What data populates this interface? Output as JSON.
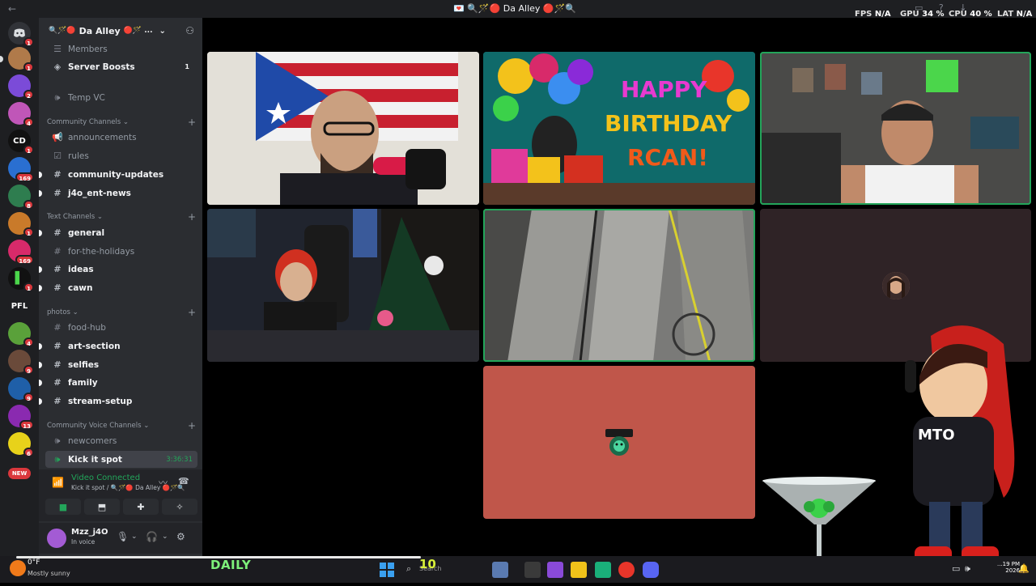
{
  "titlebar": {
    "title": "💌 🔍🪄🔴 Da Alley 🔴🪄🔍",
    "back": "←"
  },
  "perf": {
    "fps_label": "FPS",
    "fps_value": "N/A",
    "gpu_label": "GPU",
    "gpu_value": "34 %",
    "cpu_label": "CPU",
    "cpu_value": "40 %",
    "lat_label": "LAT",
    "lat_value": "N/A"
  },
  "server_rail": {
    "badges": [
      "1",
      "1",
      "2",
      "4",
      "1",
      "169",
      "8",
      "1",
      "169",
      "1",
      "4",
      "9",
      "9",
      "13",
      "6"
    ],
    "text_icons": {
      "cd": "CD",
      "pfl": "PFL"
    },
    "new_tag": "NEW"
  },
  "guild": {
    "name": "Da Alley",
    "prefix": "🔍🪄🔴",
    "suffix": "🔴🪄 ..."
  },
  "channels": {
    "members": "Members",
    "server_boosts": "Server Boosts",
    "server_boosts_badge": "1",
    "temp_vc": "Temp VC",
    "community_category": "Community Channels",
    "announcements": "announcements",
    "rules": "rules",
    "community_updates": "community-updates",
    "j4o_news": "j4o_ent-news",
    "text_category": "Text Channels",
    "general": "general",
    "holidays": "for-the-holidays",
    "ideas": "ideas",
    "cawn": "cawn",
    "photos_category": "photos",
    "food_hub": "food-hub",
    "art_section": "art-section",
    "selfies": "selfies",
    "family": "family",
    "stream_setup": "stream-setup",
    "voice_category": "Community Voice Channels",
    "newcomers": "newcomers",
    "kick_it_spot": "Kick it spot",
    "kick_it_time": "3:36:31"
  },
  "voice": {
    "status": "Video Connected",
    "location": "Kick it spot / 🔍🪄🔴 Da Alley 🔴🪄🔍"
  },
  "user": {
    "name": "Mzz_j4O",
    "status": "In voice"
  },
  "stage": {
    "birthday_line1": "HAPPY",
    "birthday_line2": "BIRTHDAY",
    "birthday_line3": "RCAN!",
    "overlay_label": "MTO"
  },
  "taskbar": {
    "temp": "0°F",
    "weather": "Mostly sunny",
    "daily": "DAILY",
    "search": "Search",
    "search_badge": "10",
    "clock_time": "...19 PM",
    "clock_date": "2026"
  },
  "colors": {
    "speaking": "#23a55a",
    "rail": "#1e1f22",
    "sidebar": "#2b2d31",
    "salmon_tile": "#c0564a"
  }
}
